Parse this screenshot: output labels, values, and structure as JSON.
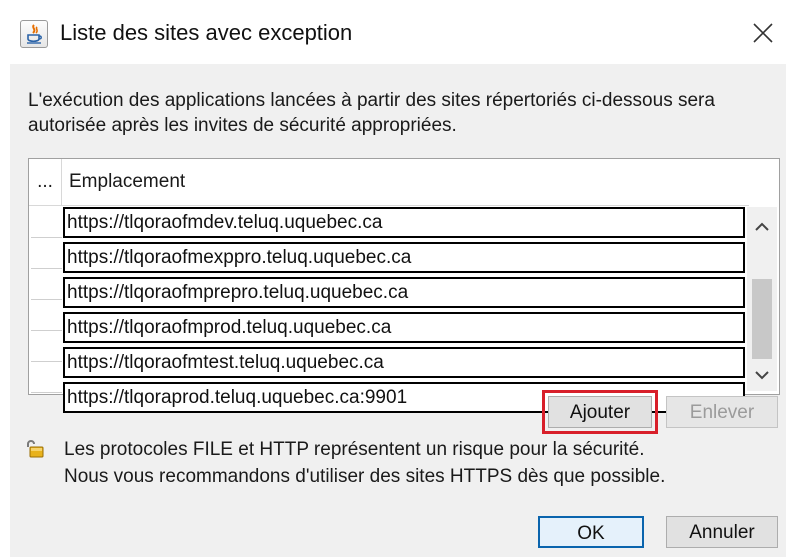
{
  "window": {
    "title": "Liste des sites avec exception",
    "app_icon": "java-icon",
    "close_icon": "close-icon"
  },
  "description": "L'exécution des applications lancées à partir des sites répertoriés ci-dessous sera autorisée après les invites de sécurité appropriées.",
  "table": {
    "columns": [
      "...",
      "Emplacement"
    ],
    "rows": [
      "https://tlqoraofmdev.teluq.uquebec.ca",
      "https://tlqoraofmexppro.teluq.uquebec.ca",
      "https://tlqoraofmprepro.teluq.uquebec.ca",
      "https://tlqoraofmprod.teluq.uquebec.ca",
      "https://tlqoraofmtest.teluq.uquebec.ca",
      "https://tlqoraprod.teluq.uquebec.ca:9901"
    ]
  },
  "buttons": {
    "add": "Ajouter",
    "remove": "Enlever",
    "ok": "OK",
    "cancel": "Annuler"
  },
  "warning": {
    "icon": "lock-icon",
    "line1": "Les protocoles FILE et HTTP représentent un risque pour la sécurité.",
    "line2": "Nous vous recommandons d'utiliser des sites HTTPS dès que possible."
  },
  "colors": {
    "highlight": "#d81f2a",
    "default_button_border": "#0a64ad"
  }
}
